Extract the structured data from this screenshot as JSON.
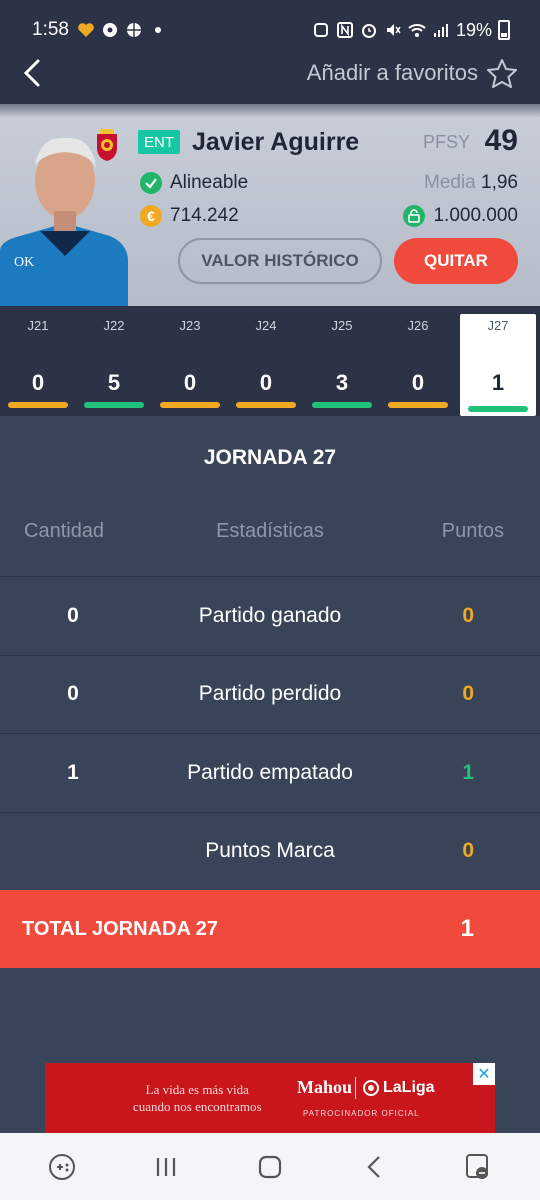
{
  "statusbar": {
    "time": "1:58",
    "battery": "19%"
  },
  "header": {
    "favorite_label": "Añadir a favoritos"
  },
  "player": {
    "position_badge": "ENT",
    "name": "Javier Aguirre",
    "pfsy_label": "PFSY",
    "pfsy_value": "49",
    "status": "Alineable",
    "media_label": "Media",
    "media_value": "1,96",
    "value": "714.242",
    "clause": "1.000.000",
    "history_button": "VALOR HISTÓRICO",
    "remove_button": "QUITAR"
  },
  "matchdays": [
    {
      "label": "J21",
      "points": "0",
      "color": "#f1a823"
    },
    {
      "label": "J22",
      "points": "5",
      "color": "#20c27a"
    },
    {
      "label": "J23",
      "points": "0",
      "color": "#f1a823"
    },
    {
      "label": "J24",
      "points": "0",
      "color": "#f1a823"
    },
    {
      "label": "J25",
      "points": "3",
      "color": "#20c27a"
    },
    {
      "label": "J26",
      "points": "0",
      "color": "#f1a823"
    },
    {
      "label": "J27",
      "points": "1",
      "color": "#20c27a"
    }
  ],
  "jornada": {
    "title": "JORNADA 27",
    "columns": {
      "quantity": "Cantidad",
      "stats": "Estadísticas",
      "points": "Puntos"
    },
    "rows": [
      {
        "qty": "0",
        "stat": "Partido ganado",
        "points": "0",
        "points_color": "#f1a823"
      },
      {
        "qty": "0",
        "stat": "Partido perdido",
        "points": "0",
        "points_color": "#f1a823"
      },
      {
        "qty": "1",
        "stat": "Partido empatado",
        "points": "1",
        "points_color": "#20c27a"
      },
      {
        "qty": "",
        "stat": "Puntos Marca",
        "points": "0",
        "points_color": "#f1a823"
      }
    ],
    "total_label": "TOTAL JORNADA 27",
    "total_value": "1"
  },
  "ad": {
    "tagline_1": "La vida es más vida",
    "tagline_2": "cuando nos encontramos",
    "brand": "Mahou",
    "league": "LaLiga",
    "sponsor": "PATROCINADOR OFICIAL"
  },
  "colors": {
    "accent_red": "#ef4a3c",
    "green": "#20c27a",
    "orange": "#f1a823",
    "background": "#3a4459",
    "strip": "#2c3346"
  }
}
